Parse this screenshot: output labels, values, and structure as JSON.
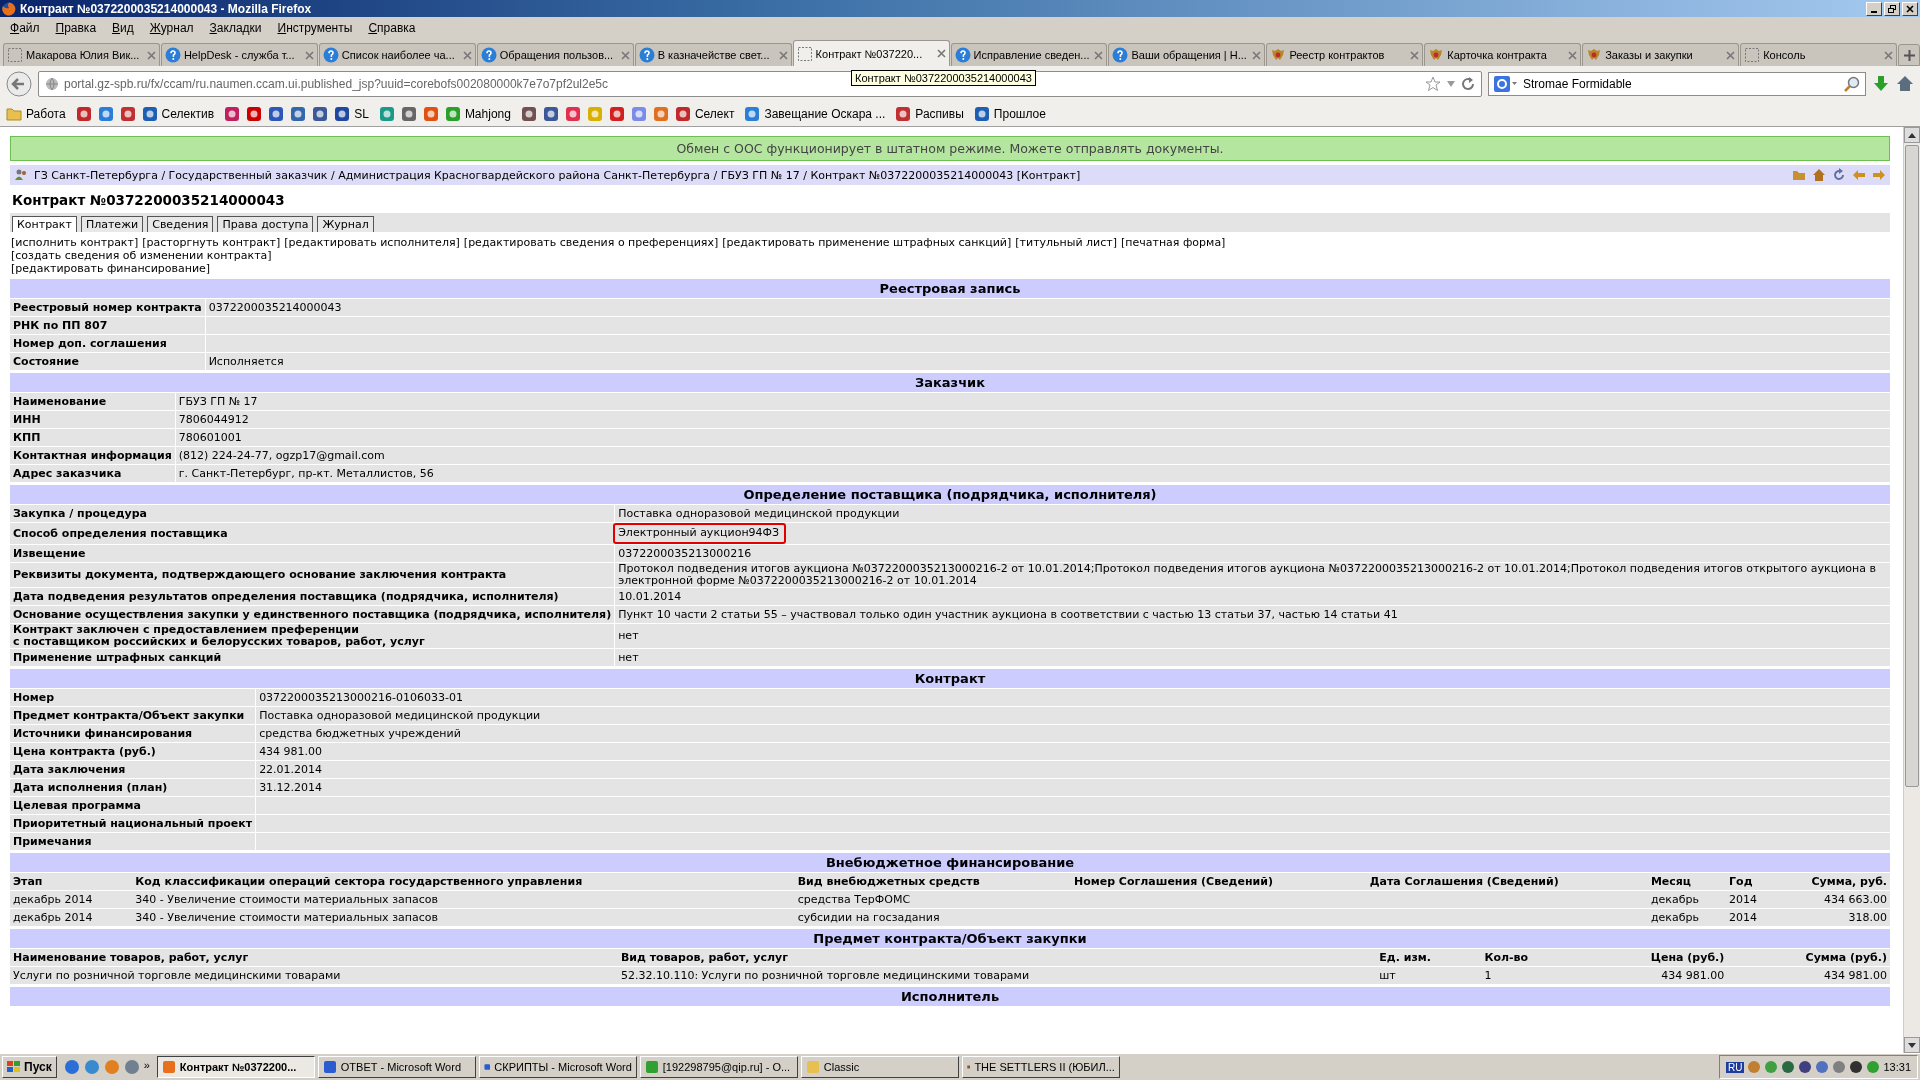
{
  "window": {
    "title": "Контракт №0372200035214000043 - Mozilla Firefox"
  },
  "menu": [
    "Файл",
    "Правка",
    "Вид",
    "Журнал",
    "Закладки",
    "Инструменты",
    "Справка"
  ],
  "tabs": [
    {
      "label": "Макарова Юлия Вик...",
      "kind": "blank",
      "selected": false
    },
    {
      "label": "HelpDesk - служба т...",
      "kind": "help",
      "selected": false
    },
    {
      "label": "Список наиболее ча...",
      "kind": "help",
      "selected": false
    },
    {
      "label": "Обращения пользов...",
      "kind": "help",
      "selected": false
    },
    {
      "label": "В казначействе свет...",
      "kind": "help",
      "selected": false
    },
    {
      "label": "Контракт №037220...",
      "kind": "blank",
      "selected": true
    },
    {
      "label": "Исправление сведен...",
      "kind": "help",
      "selected": false
    },
    {
      "label": "Ваши обращения | Н...",
      "kind": "help",
      "selected": false
    },
    {
      "label": "Реестр контрактов",
      "kind": "emblem",
      "selected": false
    },
    {
      "label": "Карточка контракта",
      "kind": "emblem",
      "selected": false
    },
    {
      "label": "Заказы и закупки",
      "kind": "emblem",
      "selected": false
    },
    {
      "label": "Консоль",
      "kind": "blank",
      "selected": false
    }
  ],
  "address": {
    "url": "portal.gz-spb.ru/fx/ccam/ru.naumen.ccam.ui.published_jsp?uuid=corebofs002080000k7e7o7pf2ul2e5c",
    "tooltip": "Контракт №0372200035214000043"
  },
  "search": {
    "value": "Stromae Formidable"
  },
  "bookmarks": [
    {
      "kind": "folder",
      "label": "Работа"
    },
    {
      "kind": "icon"
    },
    {
      "kind": "icon"
    },
    {
      "kind": "icon"
    },
    {
      "kind": "labeled",
      "label": "Селектив"
    },
    {
      "kind": "icon"
    },
    {
      "kind": "icon"
    },
    {
      "kind": "icon"
    },
    {
      "kind": "icon"
    },
    {
      "kind": "icon"
    },
    {
      "kind": "labeled",
      "label": "SL"
    },
    {
      "kind": "icon"
    },
    {
      "kind": "icon"
    },
    {
      "kind": "icon"
    },
    {
      "kind": "labeled",
      "label": "Mahjong"
    },
    {
      "kind": "icon"
    },
    {
      "kind": "icon"
    },
    {
      "kind": "icon"
    },
    {
      "kind": "icon"
    },
    {
      "kind": "icon"
    },
    {
      "kind": "icon"
    },
    {
      "kind": "icon"
    },
    {
      "kind": "labeled",
      "label": "Селект"
    },
    {
      "kind": "labeled",
      "label": "Завещание Оскара ..."
    },
    {
      "kind": "labeled",
      "label": "Распивы"
    },
    {
      "kind": "labeled",
      "label": "Прошлое"
    }
  ],
  "status_banner": "Обмен с ООС функционирует в штатном режиме. Можете отправлять документы.",
  "breadcrumb": "ГЗ Санкт-Петербурга / Государственный заказчик / Администрация Красногвардейского района Санкт-Петербурга / ГБУЗ ГП № 17 / Контракт №0372200035214000043 [Контракт]",
  "page_title": "Контракт №0372200035214000043",
  "page_tabs": [
    {
      "label": "Контракт",
      "selected": true
    },
    {
      "label": "Платежи",
      "selected": false
    },
    {
      "label": "Сведения",
      "selected": false
    },
    {
      "label": "Права доступа",
      "selected": false
    },
    {
      "label": "Журнал",
      "selected": false
    }
  ],
  "actions": [
    [
      "[исполнить контракт]",
      "[расторгнуть контракт]",
      "[редактировать исполнителя]",
      "[редактировать сведения о преференциях]",
      "[редактировать применение штрафных санкций]",
      "[титульный лист]",
      "[печатная форма]"
    ],
    [
      "[создать сведения об изменении контракта]"
    ],
    [
      "[редактировать финансирование]"
    ]
  ],
  "sections": [
    {
      "title": "Реестровая запись",
      "kind": "fields",
      "rows": [
        {
          "label": "Реестровый номер контракта",
          "value": "0372200035214000043",
          "highlighted": false
        },
        {
          "label": "РНК по ПП 807",
          "highlighted": false
        },
        {
          "label": "Номер доп. соглашения",
          "highlighted": false
        },
        {
          "label": "Состояние",
          "value": "Исполняется",
          "highlighted": false
        }
      ]
    },
    {
      "title": "Заказчик",
      "kind": "fields",
      "rows": [
        {
          "label": "Наименование",
          "value": "ГБУЗ ГП № 17",
          "highlighted": false
        },
        {
          "label": "ИНН",
          "value": "7806044912",
          "highlighted": false
        },
        {
          "label": "КПП",
          "value": "780601001",
          "highlighted": false
        },
        {
          "label": "Контактная информация",
          "value": "(812) 224-24-77, ogzp17@gmail.com",
          "highlighted": false
        },
        {
          "label": "Адрес заказчика",
          "value": "г. Санкт-Петербург, пр-кт. Металлистов, 56",
          "highlighted": false
        }
      ]
    },
    {
      "title": "Определение поставщика (подрядчика, исполнителя)",
      "kind": "fields",
      "rows": [
        {
          "label": "Закупка / процедура",
          "value": "Поставка одноразовой медицинской продукции",
          "highlighted": false
        },
        {
          "label": "Способ определения поставщика",
          "value": "Электронный аукцион94ФЗ",
          "highlighted": true
        },
        {
          "label": "Извещение",
          "value": "0372200035213000216",
          "highlighted": false
        },
        {
          "label": "Реквизиты документа, подтверждающего основание заключения контракта",
          "value": "Протокол подведения итогов аукциона №0372200035213000216-2 от 10.01.2014;Протокол подведения итогов аукциона №0372200035213000216-2 от 10.01.2014;Протокол подведения итогов открытого аукциона в электронной форме №0372200035213000216-2 от 10.01.2014",
          "highlighted": false
        },
        {
          "label": "Дата подведения результатов определения поставщика (подрядчика, исполнителя)",
          "value": "10.01.2014",
          "highlighted": false
        },
        {
          "label": "Основание осуществления закупки у единственного поставщика (подрядчика, исполнителя)",
          "value": "Пункт 10 части 2 статьи 55 – участвовал только один участник аукциона в соответствии с частью 13 статьи 37, частью 14 статьи 41",
          "highlighted": false
        },
        {
          "label": "Контракт заключен с предоставлением преференции\nс поставщиком российских и белорусских товаров, работ, услуг",
          "value": "нет",
          "highlighted": false
        },
        {
          "label": "Применение штрафных санкций",
          "value": "нет",
          "highlighted": false
        }
      ]
    },
    {
      "title": "Контракт",
      "kind": "fields",
      "rows": [
        {
          "label": "Номер",
          "value": "0372200035213000216-0106033-01",
          "highlighted": false
        },
        {
          "label": "Предмет контракта/Объект закупки",
          "value": "Поставка одноразовой медицинской продукции",
          "highlighted": false
        },
        {
          "label": "Источники финансирования",
          "value": "средства бюджетных учреждений",
          "highlighted": false
        },
        {
          "label": "Цена контракта (руб.)",
          "value": "434 981.00",
          "highlighted": false
        },
        {
          "label": "Дата заключения",
          "value": "22.01.2014",
          "highlighted": false
        },
        {
          "label": "Дата исполнения (план)",
          "value": "31.12.2014",
          "highlighted": false
        },
        {
          "label": "Целевая программа",
          "highlighted": false
        },
        {
          "label": "Приоритетный национальный проект",
          "highlighted": false
        },
        {
          "label": "Примечания",
          "highlighted": false
        }
      ]
    },
    {
      "title": "Внебюджетное финансирование",
      "kind": "table",
      "columns": [
        {
          "label": "Этап",
          "numeric": false
        },
        {
          "label": "Код классификации операций сектора государственного управления",
          "numeric": false
        },
        {
          "label": "Вид внебюджетных средств",
          "numeric": false
        },
        {
          "label": "Номер Соглашения (Сведений)",
          "numeric": false
        },
        {
          "label": "Дата Соглашения (Сведений)",
          "numeric": false
        },
        {
          "label": "Месяц",
          "numeric": false
        },
        {
          "label": "Год",
          "numeric": false
        },
        {
          "label": "Сумма, руб.",
          "numeric": true
        }
      ],
      "rows": [
        [
          "декабрь 2014",
          "340 - Увеличение стоимости материальных запасов",
          "средства ТерФОМС",
          "",
          "",
          "декабрь",
          "2014",
          "434 663.00"
        ],
        [
          "декабрь 2014",
          "340 - Увеличение стоимости материальных запасов",
          "субсидии на госзадания",
          "",
          "",
          "декабрь",
          "2014",
          "318.00"
        ]
      ]
    },
    {
      "title": "Предмет контракта/Объект закупки",
      "kind": "table",
      "columns": [
        {
          "label": "Наименование товаров, работ, услуг",
          "numeric": false
        },
        {
          "label": "Вид товаров, работ, услуг",
          "numeric": false
        },
        {
          "label": "Ед. изм.",
          "numeric": false
        },
        {
          "label": "Кол-во",
          "numeric": false
        },
        {
          "label": "Цена (руб.)",
          "numeric": true
        },
        {
          "label": "Сумма (руб.)",
          "numeric": true
        }
      ],
      "rows": [
        [
          "Услуги по розничной торговле медицинскими товарами",
          "52.32.10.110: Услуги по розничной торговле медицинскими товарами",
          "шт",
          "1",
          "434 981.00",
          "434 981.00"
        ]
      ]
    },
    {
      "title": "Исполнитель",
      "kind": "fields"
    }
  ],
  "taskbar": {
    "start": "Пуск",
    "more": "»",
    "tasks": [
      {
        "label": "Контракт №0372200...",
        "selected": true
      },
      {
        "label": "ОТВЕТ - Microsoft Word",
        "selected": false
      },
      {
        "label": "СКРИПТЫ - Microsoft Word",
        "selected": false
      },
      {
        "label": "[192298795@qip.ru] - О...",
        "selected": false
      },
      {
        "label": "Classic",
        "selected": false
      },
      {
        "label": "THE SETTLERS II (ЮБИЛ...",
        "selected": false
      }
    ],
    "language": "RU",
    "clock": "13:31"
  }
}
